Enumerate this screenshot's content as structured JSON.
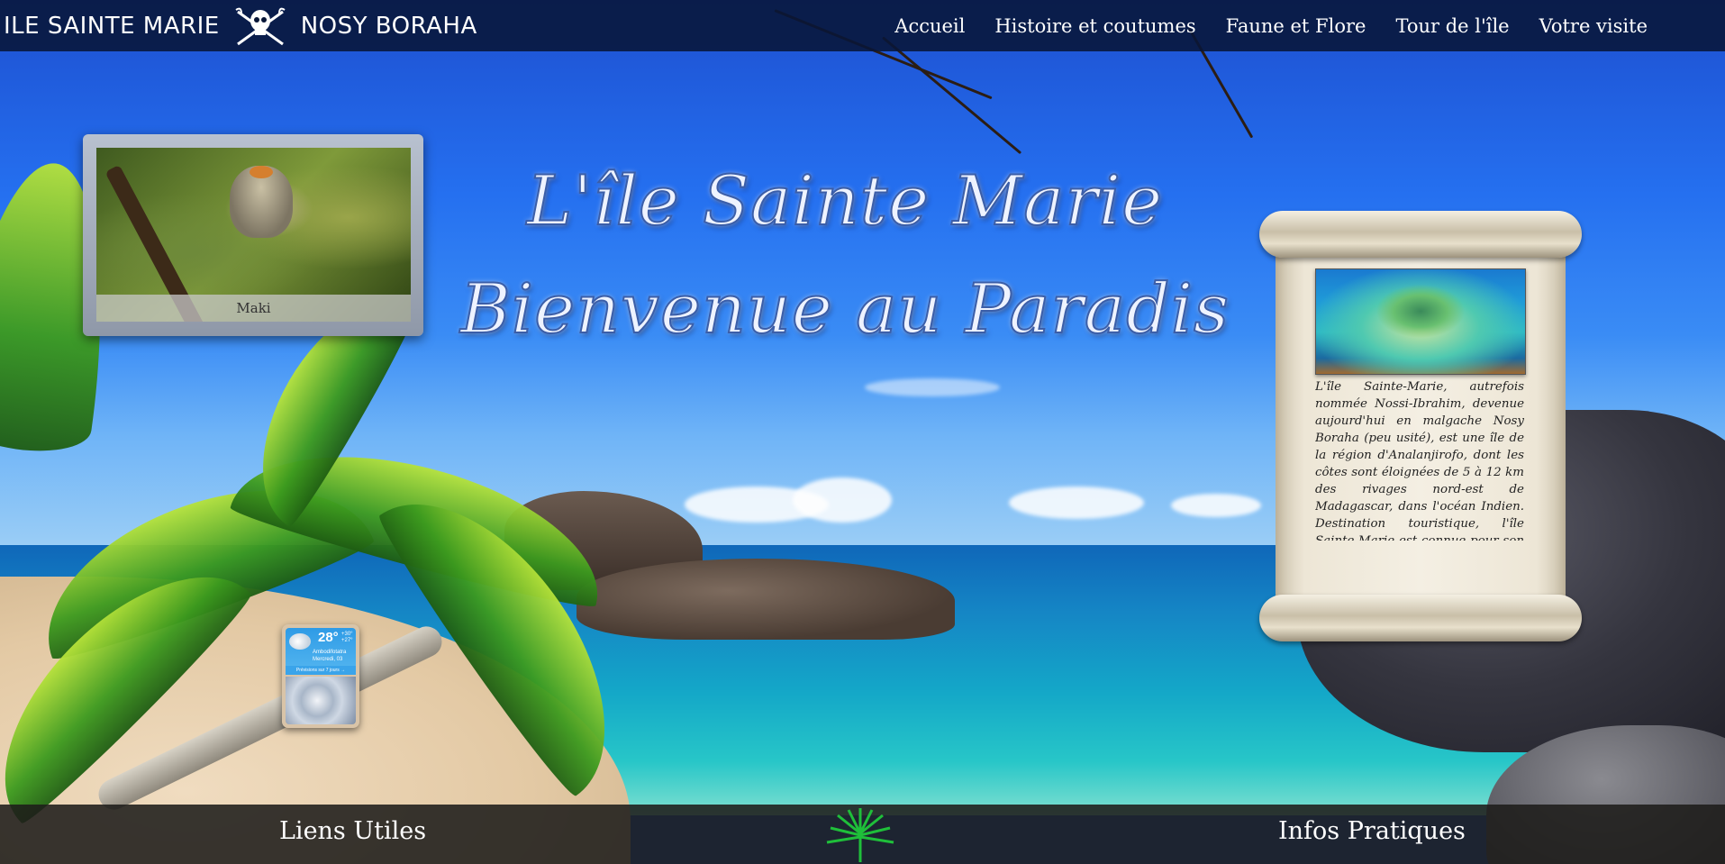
{
  "nav": {
    "brand_left": "ILE SAINTE MARIE",
    "brand_right": "NOSY BORAHA",
    "brand_icon": "skull-crossbones-icon",
    "links": [
      "Accueil",
      "Histoire et coutumes",
      "Faune et Flore",
      "Tour de l'île",
      "Votre visite"
    ]
  },
  "hero": {
    "line1": "L'île Sainte Marie",
    "line2": "Bienvenue au Paradis"
  },
  "photo_card": {
    "caption": "Maki"
  },
  "weather": {
    "temp": "28°",
    "max": "+30°",
    "min": "+27°",
    "city": "Ambodifotatra",
    "date": "Mercredi, 03",
    "link": "Prévisions sur 7 jours →"
  },
  "scroll": {
    "text": "L'île Sainte-Marie, autrefois nommée Nossi-Ibrahim, devenue aujourd'hui en malgache Nosy Boraha (peu usité), est une île de la région d'Analanjirofo, dont les côtes sont éloignées de 5 à 12 km des rivages nord-est de Madagascar, dans l'océan Indien. Destination touristique, l'île Sainte-Marie est connue pour son caractère authentique et préservé, ses regroupements de"
  },
  "footer": {
    "left_title": "Liens Utiles",
    "right_title": "Infos Pratiques",
    "logo_icon": "traveller-palm-icon"
  },
  "colors": {
    "navbar": "#081638",
    "footer": "#1e1c1a",
    "logo_green": "#1fbf3a"
  }
}
